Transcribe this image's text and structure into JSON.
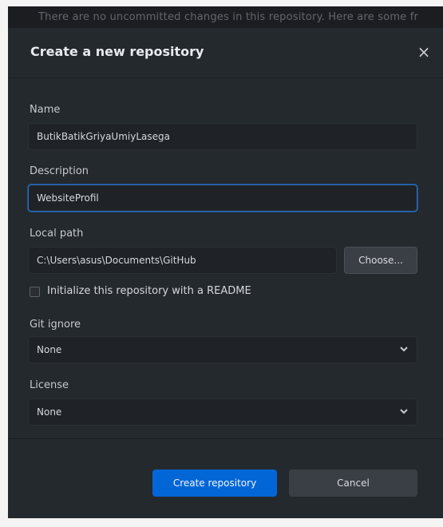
{
  "backdrop_text": "There are no uncommitted changes in this repository. Here are some fr",
  "dialog": {
    "title": "Create a new repository",
    "close_glyph": "×"
  },
  "fields": {
    "name": {
      "label": "Name",
      "value": "ButikBatikGriyaUmiyLasega"
    },
    "description": {
      "label": "Description",
      "value": "WebsiteProfil"
    },
    "local_path": {
      "label": "Local path",
      "value": "C:\\Users\\asus\\Documents\\GitHub",
      "choose_label": "Choose..."
    },
    "readme": {
      "label": "Initialize this repository with a README",
      "checked": false
    },
    "git_ignore": {
      "label": "Git ignore",
      "value": "None"
    },
    "license": {
      "label": "License",
      "value": "None"
    }
  },
  "buttons": {
    "create": "Create repository",
    "cancel": "Cancel"
  },
  "icons": {
    "close": "close-icon",
    "chevron": "chevron-down-icon"
  },
  "colors": {
    "dialog_bg": "#24292e",
    "primary": "#0366d6",
    "focus": "#2f6fbf"
  }
}
